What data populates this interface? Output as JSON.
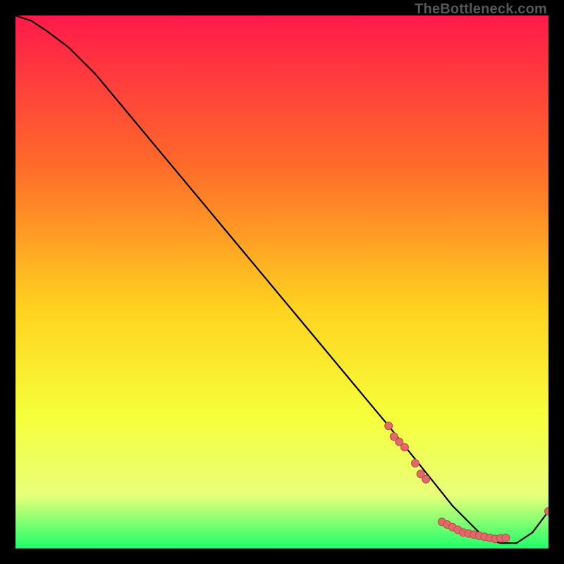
{
  "watermark": "TheBottleneck.com",
  "colors": {
    "gradient_top": "#ff1a4a",
    "gradient_mid1": "#ff6a2a",
    "gradient_mid2": "#ffd21f",
    "gradient_mid3": "#f6ff3a",
    "gradient_bottom_yellow": "#e8ff7a",
    "gradient_bottom_green": "#1eff6a",
    "curve": "#000000",
    "dot_fill": "#e06a6a",
    "dot_stroke": "#c04a4a",
    "background": "#000000"
  },
  "chart_data": {
    "type": "line",
    "title": "",
    "xlabel": "",
    "ylabel": "",
    "xlim": [
      0,
      100
    ],
    "ylim": [
      0,
      100
    ],
    "grid": false,
    "legend": false,
    "series": [
      {
        "name": "bottleneck-curve",
        "x": [
          0,
          3,
          6,
          10,
          15,
          20,
          25,
          30,
          35,
          40,
          45,
          50,
          55,
          60,
          65,
          70,
          74,
          78,
          82,
          85,
          88,
          91,
          94,
          97,
          100
        ],
        "y": [
          100,
          99,
          97,
          94,
          89,
          83,
          77,
          71,
          65,
          59,
          53,
          47,
          41,
          35,
          29,
          23,
          18,
          13,
          8,
          5,
          2,
          1,
          1,
          3,
          7
        ]
      }
    ],
    "points": [
      {
        "name": "cluster-upper-1",
        "x": 70,
        "y": 23
      },
      {
        "name": "cluster-upper-2",
        "x": 71,
        "y": 21
      },
      {
        "name": "cluster-upper-3",
        "x": 72,
        "y": 20
      },
      {
        "name": "cluster-upper-4",
        "x": 73,
        "y": 19
      },
      {
        "name": "cluster-mid-1",
        "x": 75,
        "y": 16
      },
      {
        "name": "cluster-mid-2",
        "x": 76,
        "y": 14
      },
      {
        "name": "cluster-mid-3",
        "x": 77,
        "y": 13
      },
      {
        "name": "bottom-1",
        "x": 80,
        "y": 5
      },
      {
        "name": "bottom-2",
        "x": 81,
        "y": 4.5
      },
      {
        "name": "bottom-3",
        "x": 82,
        "y": 4
      },
      {
        "name": "bottom-4",
        "x": 83,
        "y": 3.5
      },
      {
        "name": "bottom-5",
        "x": 84,
        "y": 3
      },
      {
        "name": "bottom-6",
        "x": 85,
        "y": 2.8
      },
      {
        "name": "bottom-7",
        "x": 86,
        "y": 2.6
      },
      {
        "name": "bottom-8",
        "x": 87,
        "y": 2.4
      },
      {
        "name": "bottom-9",
        "x": 88,
        "y": 2.2
      },
      {
        "name": "bottom-10",
        "x": 89,
        "y": 2
      },
      {
        "name": "bottom-11",
        "x": 90,
        "y": 1.8
      },
      {
        "name": "bottom-12",
        "x": 91,
        "y": 1.9
      },
      {
        "name": "bottom-13",
        "x": 92,
        "y": 2
      },
      {
        "name": "tail-1",
        "x": 100,
        "y": 7
      }
    ]
  }
}
